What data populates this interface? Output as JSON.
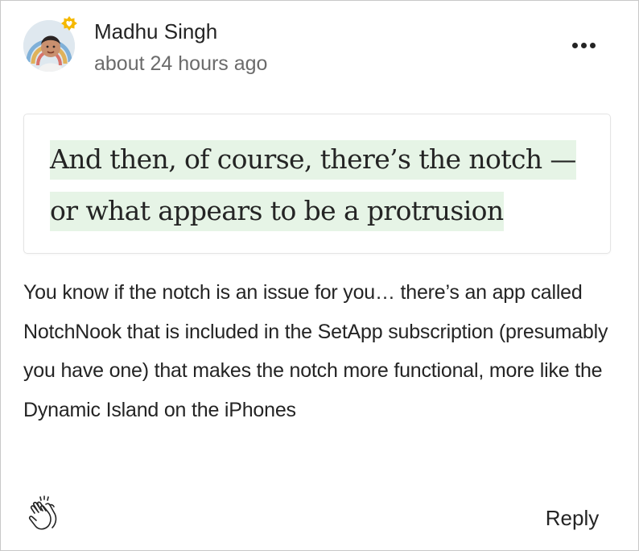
{
  "comment": {
    "author": {
      "name": "Madhu Singh",
      "avatar_icon": "user-avatar-photo",
      "badge_icon": "member-star-badge",
      "badge_color": "#F5B800"
    },
    "timestamp": "about 24 hours ago",
    "more_icon": "more-options-icon",
    "highlight": {
      "text": "And then, of course, there’s the notch — or what appears to be a protrusion",
      "highlight_color": "#E6F4E6"
    },
    "body": "You know if the notch is an issue for you… there’s an app called NotchNook that is included in the SetApp subscription (presumably you have one) that makes the notch more functional, more like the Dynamic Island on the iPhones",
    "actions": {
      "clap_icon": "clap-icon",
      "reply_label": "Reply"
    }
  }
}
